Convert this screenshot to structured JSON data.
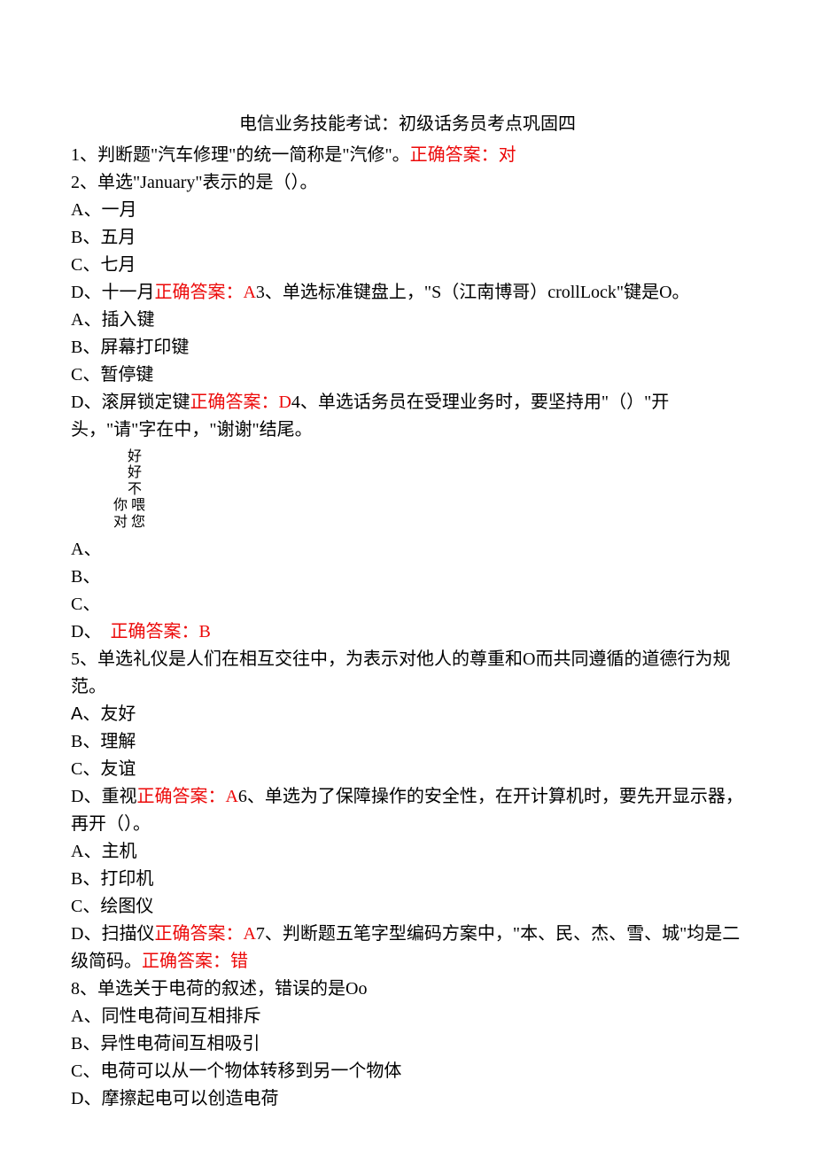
{
  "title": "电信业务技能考试：初级话务员考点巩固四",
  "q1": {
    "prefix": "1、判断题\"汽车修理\"的统一简称是\"汽修\"。",
    "ans": "正确答案：对"
  },
  "q2": {
    "stem": "2、单选\"January\"表示的是（）。",
    "a": "A、一月",
    "b": "B、五月",
    "c": "C、七月",
    "d_prefix": "D、十一月",
    "d_ans": "正确答案：A",
    "q3_run": "3、单选标准键盘上，\"S（江南博哥）crollLock\"键是O。"
  },
  "q3": {
    "a": "A、插入键",
    "b": "B、屏幕打印键",
    "c": "C、暂停键",
    "d_prefix": "D、滚屏锁定键",
    "d_ans": "正确答案：D",
    "q4_run": "4、单选话务员在受理业务时，要坚持用\"（）\"开头，\"请\"字在中，\"谢谢\"结尾。"
  },
  "stack": {
    "r1": "好",
    "r2": "好",
    "r3": "不",
    "r4": "你 喂",
    "r5": "对 您"
  },
  "q4": {
    "a": "A、",
    "b": "B、",
    "c": "C、",
    "d_prefix": "D、　",
    "d_ans": "正确答案：B"
  },
  "q5": {
    "stem": "5、单选礼仪是人们在相互交往中，为表示对他人的尊重和O而共同遵循的道德行为规范。",
    "a_prefix": "A",
    "a_rest": "、友好",
    "b": "B、理解",
    "c": "C、友谊",
    "d_prefix": "D、重视",
    "d_ans": "正确答案：A",
    "q6_run": "6、单选为了保障操作的安全性，在开计算机时，要先开显示器，再开（）。"
  },
  "q6": {
    "a": "A、主机",
    "b": "B、打印机",
    "c": "C、绘图仪",
    "d_prefix": "D、扫描仪",
    "d_ans": "正确答案：A",
    "q7_run": "7、判断题五笔字型编码方案中，\"本、民、杰、雪、城\"均是二级简码。",
    "q7_ans": "正确答案：错"
  },
  "q8": {
    "stem": "8、单选关于电荷的叙述，错误的是Oo",
    "a": "A、同性电荷间互相排斥",
    "b": "B、异性电荷间互相吸引",
    "c": "C、电荷可以从一个物体转移到另一个物体",
    "d": "D、摩擦起电可以创造电荷"
  }
}
